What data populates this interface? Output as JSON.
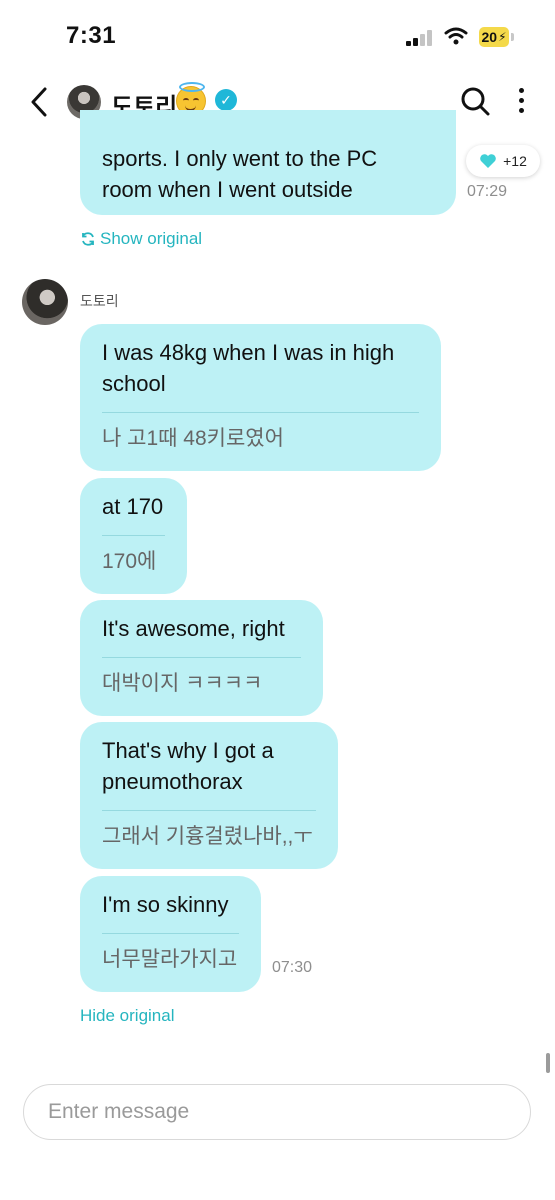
{
  "status_bar": {
    "time": "7:31",
    "battery": "20"
  },
  "header": {
    "contact_name": "도토리"
  },
  "messages": [
    {
      "english_lines": [
        "sports. I only went to the PC",
        "room when I went outside"
      ],
      "time": "07:29",
      "reaction_count": "+12",
      "toggle_label": "Show original"
    },
    {
      "sender": "도토리"
    },
    {
      "english": "I was 48kg when I was in high school",
      "korean": "나 고1때 48키로였어"
    },
    {
      "english": "at 170",
      "korean": "170에"
    },
    {
      "english": "It's awesome, right",
      "korean": "대박이지 ㅋㅋㅋㅋ"
    },
    {
      "english": "That's why I got a pneumothorax",
      "korean": "그래서 기흉걸렸나바,,ㅜ"
    },
    {
      "english": "I'm so skinny",
      "korean": "너무말라가지고",
      "time": "07:30",
      "toggle_label": "Hide original"
    }
  ],
  "composer": {
    "placeholder": "Enter message"
  },
  "colors": {
    "bubble": "#bdf1f5",
    "accent": "#25b5bf",
    "verified": "#1fb7d8",
    "reaction_heart": "#3fd0d6"
  },
  "icons": [
    "back-arrow-icon",
    "verified-check-icon",
    "search-icon",
    "more-vertical-icon",
    "heart-icon",
    "translate-refresh-icon"
  ]
}
